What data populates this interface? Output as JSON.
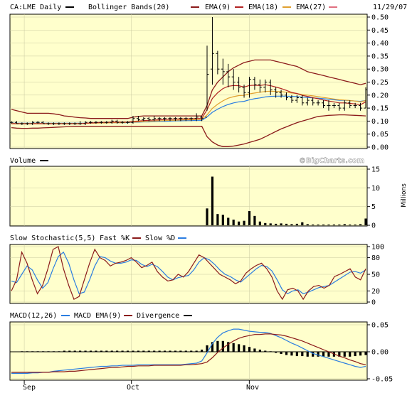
{
  "colors": {
    "panel_bg": "#ffffcc",
    "frame": "#000000",
    "grid": "#c8c8a0",
    "price_bar": "#000000",
    "bollinger": "#8b1a1a",
    "ema9": "#b22222",
    "ema18": "#e0a030",
    "ema27": "#2a7de1",
    "ema27_legend": "#e07080",
    "fast_k": "#8b1a1a",
    "slow_d": "#2a7de1",
    "macd": "#2a7de1",
    "macd_ema": "#8b1a1a",
    "divergence": "#000000"
  },
  "date": "11/29/07",
  "watermark": "©BigCharts.com",
  "month_labels": [
    "Sep",
    "Oct",
    "Nov"
  ],
  "chart_data": [
    {
      "type": "line",
      "panel": "price",
      "legend": [
        "CA:LME Daily",
        "Bollinger Bands(20)",
        "EMA(9)",
        "EMA(18)",
        "EMA(27)"
      ],
      "ylim": [
        0,
        0.5
      ],
      "yticks": [
        "0.50",
        "0.45",
        "0.40",
        "0.35",
        "0.30",
        "0.25",
        "0.20",
        "0.15",
        "0.10",
        "0.05",
        "0.00"
      ],
      "x_dates": [
        "Sep",
        "Oct",
        "Nov"
      ],
      "bars_ohlc": [
        [
          0.095,
          0.1,
          0.09,
          0.095
        ],
        [
          0.095,
          0.1,
          0.09,
          0.09
        ],
        [
          0.09,
          0.095,
          0.085,
          0.09
        ],
        [
          0.09,
          0.095,
          0.085,
          0.09
        ],
        [
          0.09,
          0.1,
          0.085,
          0.095
        ],
        [
          0.095,
          0.1,
          0.09,
          0.095
        ],
        [
          0.095,
          0.1,
          0.09,
          0.09
        ],
        [
          0.09,
          0.095,
          0.085,
          0.09
        ],
        [
          0.09,
          0.095,
          0.085,
          0.09
        ],
        [
          0.09,
          0.095,
          0.085,
          0.09
        ],
        [
          0.09,
          0.095,
          0.085,
          0.09
        ],
        [
          0.09,
          0.095,
          0.085,
          0.09
        ],
        [
          0.09,
          0.095,
          0.085,
          0.09
        ],
        [
          0.09,
          0.1,
          0.085,
          0.09
        ],
        [
          0.09,
          0.1,
          0.085,
          0.095
        ],
        [
          0.095,
          0.1,
          0.09,
          0.095
        ],
        [
          0.095,
          0.1,
          0.09,
          0.095
        ],
        [
          0.095,
          0.1,
          0.09,
          0.095
        ],
        [
          0.095,
          0.1,
          0.09,
          0.095
        ],
        [
          0.095,
          0.105,
          0.09,
          0.1
        ],
        [
          0.1,
          0.105,
          0.09,
          0.095
        ],
        [
          0.095,
          0.1,
          0.09,
          0.095
        ],
        [
          0.095,
          0.1,
          0.09,
          0.095
        ],
        [
          0.095,
          0.12,
          0.09,
          0.11
        ],
        [
          0.11,
          0.12,
          0.1,
          0.105
        ],
        [
          0.105,
          0.115,
          0.1,
          0.11
        ],
        [
          0.11,
          0.115,
          0.1,
          0.105
        ],
        [
          0.105,
          0.12,
          0.1,
          0.11
        ],
        [
          0.11,
          0.115,
          0.1,
          0.11
        ],
        [
          0.11,
          0.115,
          0.1,
          0.11
        ],
        [
          0.11,
          0.115,
          0.1,
          0.11
        ],
        [
          0.11,
          0.115,
          0.1,
          0.11
        ],
        [
          0.11,
          0.115,
          0.1,
          0.11
        ],
        [
          0.11,
          0.115,
          0.1,
          0.11
        ],
        [
          0.11,
          0.115,
          0.1,
          0.11
        ],
        [
          0.11,
          0.13,
          0.1,
          0.115
        ],
        [
          0.115,
          0.12,
          0.1,
          0.11
        ],
        [
          0.115,
          0.39,
          0.14,
          0.28
        ],
        [
          0.3,
          0.5,
          0.24,
          0.36
        ],
        [
          0.36,
          0.37,
          0.28,
          0.3
        ],
        [
          0.3,
          0.34,
          0.24,
          0.29
        ],
        [
          0.29,
          0.32,
          0.23,
          0.27
        ],
        [
          0.27,
          0.3,
          0.22,
          0.25
        ],
        [
          0.25,
          0.27,
          0.21,
          0.23
        ],
        [
          0.23,
          0.24,
          0.19,
          0.21
        ],
        [
          0.21,
          0.27,
          0.19,
          0.26
        ],
        [
          0.26,
          0.27,
          0.22,
          0.24
        ],
        [
          0.24,
          0.26,
          0.21,
          0.23
        ],
        [
          0.23,
          0.26,
          0.21,
          0.25
        ],
        [
          0.25,
          0.26,
          0.2,
          0.22
        ],
        [
          0.22,
          0.23,
          0.19,
          0.21
        ],
        [
          0.21,
          0.22,
          0.19,
          0.2
        ],
        [
          0.2,
          0.21,
          0.18,
          0.19
        ],
        [
          0.19,
          0.2,
          0.17,
          0.18
        ],
        [
          0.18,
          0.2,
          0.17,
          0.19
        ],
        [
          0.19,
          0.2,
          0.16,
          0.17
        ],
        [
          0.17,
          0.19,
          0.16,
          0.18
        ],
        [
          0.18,
          0.19,
          0.16,
          0.17
        ],
        [
          0.17,
          0.18,
          0.16,
          0.17
        ],
        [
          0.17,
          0.18,
          0.15,
          0.16
        ],
        [
          0.16,
          0.18,
          0.14,
          0.16
        ],
        [
          0.16,
          0.17,
          0.15,
          0.16
        ],
        [
          0.16,
          0.17,
          0.14,
          0.15
        ],
        [
          0.15,
          0.18,
          0.14,
          0.17
        ],
        [
          0.17,
          0.18,
          0.15,
          0.16
        ],
        [
          0.16,
          0.17,
          0.15,
          0.16
        ],
        [
          0.16,
          0.17,
          0.14,
          0.15
        ],
        [
          0.15,
          0.23,
          0.15,
          0.22
        ]
      ],
      "bollinger_upper": [
        0.145,
        0.14,
        0.135,
        0.13,
        0.13,
        0.13,
        0.13,
        0.13,
        0.128,
        0.125,
        0.12,
        0.118,
        0.115,
        0.113,
        0.112,
        0.11,
        0.11,
        0.11,
        0.11,
        0.11,
        0.11,
        0.11,
        0.11,
        0.115,
        0.118,
        0.12,
        0.12,
        0.12,
        0.12,
        0.12,
        0.12,
        0.12,
        0.12,
        0.12,
        0.12,
        0.12,
        0.12,
        0.16,
        0.22,
        0.25,
        0.27,
        0.29,
        0.305,
        0.315,
        0.325,
        0.33,
        0.335,
        0.335,
        0.335,
        0.335,
        0.33,
        0.325,
        0.32,
        0.315,
        0.31,
        0.3,
        0.29,
        0.285,
        0.28,
        0.275,
        0.27,
        0.265,
        0.26,
        0.255,
        0.25,
        0.245,
        0.24,
        0.245
      ],
      "bollinger_lower": [
        0.075,
        0.073,
        0.072,
        0.072,
        0.073,
        0.073,
        0.074,
        0.075,
        0.076,
        0.077,
        0.078,
        0.079,
        0.08,
        0.08,
        0.08,
        0.08,
        0.08,
        0.08,
        0.08,
        0.08,
        0.08,
        0.08,
        0.08,
        0.08,
        0.08,
        0.08,
        0.08,
        0.08,
        0.08,
        0.08,
        0.08,
        0.08,
        0.08,
        0.08,
        0.08,
        0.08,
        0.08,
        0.04,
        0.02,
        0.008,
        0.002,
        0.002,
        0.004,
        0.008,
        0.012,
        0.018,
        0.024,
        0.03,
        0.04,
        0.05,
        0.06,
        0.07,
        0.078,
        0.086,
        0.094,
        0.1,
        0.106,
        0.112,
        0.118,
        0.12,
        0.122,
        0.123,
        0.124,
        0.124,
        0.123,
        0.122,
        0.121,
        0.12
      ],
      "ema9": [
        0.09,
        0.09,
        0.09,
        0.09,
        0.09,
        0.09,
        0.09,
        0.09,
        0.09,
        0.09,
        0.09,
        0.09,
        0.09,
        0.09,
        0.092,
        0.093,
        0.094,
        0.095,
        0.095,
        0.096,
        0.096,
        0.096,
        0.096,
        0.099,
        0.1,
        0.102,
        0.103,
        0.104,
        0.105,
        0.106,
        0.107,
        0.108,
        0.108,
        0.109,
        0.109,
        0.11,
        0.11,
        0.144,
        0.187,
        0.209,
        0.225,
        0.234,
        0.237,
        0.236,
        0.231,
        0.237,
        0.238,
        0.237,
        0.24,
        0.236,
        0.231,
        0.225,
        0.218,
        0.21,
        0.206,
        0.199,
        0.195,
        0.19,
        0.186,
        0.181,
        0.177,
        0.174,
        0.17,
        0.17,
        0.168,
        0.166,
        0.163,
        0.174
      ],
      "ema18": [
        0.091,
        0.091,
        0.091,
        0.091,
        0.091,
        0.091,
        0.091,
        0.091,
        0.091,
        0.091,
        0.091,
        0.091,
        0.091,
        0.091,
        0.091,
        0.092,
        0.092,
        0.093,
        0.093,
        0.094,
        0.094,
        0.094,
        0.095,
        0.096,
        0.097,
        0.098,
        0.099,
        0.1,
        0.101,
        0.102,
        0.103,
        0.103,
        0.104,
        0.105,
        0.105,
        0.106,
        0.106,
        0.124,
        0.149,
        0.165,
        0.178,
        0.188,
        0.194,
        0.198,
        0.199,
        0.205,
        0.208,
        0.211,
        0.214,
        0.215,
        0.214,
        0.213,
        0.211,
        0.208,
        0.206,
        0.202,
        0.2,
        0.197,
        0.194,
        0.191,
        0.188,
        0.185,
        0.182,
        0.181,
        0.179,
        0.177,
        0.174,
        0.179
      ],
      "ema27": [
        0.092,
        0.092,
        0.092,
        0.092,
        0.092,
        0.092,
        0.092,
        0.092,
        0.092,
        0.092,
        0.092,
        0.092,
        0.092,
        0.092,
        0.092,
        0.092,
        0.093,
        0.093,
        0.093,
        0.094,
        0.094,
        0.094,
        0.094,
        0.095,
        0.096,
        0.097,
        0.097,
        0.098,
        0.099,
        0.099,
        0.1,
        0.101,
        0.101,
        0.102,
        0.102,
        0.103,
        0.103,
        0.116,
        0.134,
        0.146,
        0.156,
        0.164,
        0.17,
        0.174,
        0.176,
        0.182,
        0.186,
        0.189,
        0.193,
        0.195,
        0.196,
        0.196,
        0.196,
        0.195,
        0.194,
        0.192,
        0.191,
        0.189,
        0.188,
        0.186,
        0.184,
        0.182,
        0.18,
        0.18,
        0.179,
        0.177,
        0.176,
        0.179
      ]
    },
    {
      "type": "bar",
      "panel": "volume",
      "legend": [
        "Volume"
      ],
      "ylabel": "Millions",
      "ylim": [
        0,
        15
      ],
      "yticks": [
        "15",
        "10",
        "5",
        "0"
      ],
      "values": [
        0,
        0,
        0,
        0,
        0,
        0,
        0,
        0,
        0,
        0,
        0,
        0,
        0,
        0,
        0,
        0,
        0,
        0,
        0,
        0,
        0,
        0,
        0,
        0,
        0,
        0,
        0,
        0,
        0,
        0,
        0,
        0,
        0,
        0,
        0,
        0,
        0,
        4.5,
        13,
        3,
        2.8,
        2,
        1.5,
        1,
        1.2,
        3.8,
        2.5,
        1,
        0.6,
        0.5,
        0.4,
        0.5,
        0.4,
        0.3,
        0.4,
        0.8,
        0.3,
        0.2,
        0.2,
        0.2,
        0.2,
        0.2,
        0.2,
        0.3,
        0.2,
        0.2,
        0.3,
        1.8
      ]
    },
    {
      "type": "line",
      "panel": "stochastic",
      "legend": [
        "Slow Stochastic(5,5)",
        "Fast %K",
        "Slow %D"
      ],
      "ylim": [
        0,
        100
      ],
      "yticks": [
        "100",
        "80",
        "50",
        "20",
        "0"
      ],
      "fast_k": [
        20,
        40,
        90,
        70,
        40,
        15,
        30,
        60,
        95,
        100,
        60,
        30,
        5,
        10,
        40,
        70,
        95,
        80,
        75,
        65,
        70,
        72,
        75,
        80,
        72,
        62,
        66,
        72,
        55,
        45,
        38,
        40,
        50,
        45,
        55,
        70,
        85,
        80,
        70,
        60,
        50,
        45,
        40,
        33,
        38,
        52,
        60,
        66,
        70,
        60,
        45,
        20,
        5,
        22,
        25,
        20,
        5,
        20,
        28,
        30,
        25,
        30,
        46,
        50,
        55,
        60,
        45,
        40,
        60
      ],
      "slow_d": [
        38,
        35,
        50,
        65,
        58,
        40,
        25,
        35,
        60,
        82,
        90,
        70,
        40,
        15,
        18,
        40,
        65,
        82,
        80,
        74,
        70,
        70,
        72,
        76,
        75,
        68,
        64,
        68,
        64,
        55,
        45,
        40,
        44,
        46,
        48,
        58,
        72,
        80,
        76,
        68,
        58,
        50,
        46,
        40,
        36,
        44,
        52,
        60,
        66,
        64,
        56,
        40,
        22,
        15,
        20,
        22,
        15,
        18,
        22,
        26,
        28,
        30,
        36,
        42,
        48,
        54,
        55,
        52,
        58
      ]
    },
    {
      "type": "line",
      "panel": "macd",
      "legend": [
        "MACD(12,26)",
        "MACD EMA(9)",
        "Divergence"
      ],
      "ylim": [
        -0.05,
        0.05
      ],
      "yticks": [
        "0.05",
        "0.00",
        "-0.05"
      ],
      "macd": [
        -0.04,
        -0.04,
        -0.04,
        -0.04,
        -0.039,
        -0.039,
        -0.038,
        -0.038,
        -0.036,
        -0.035,
        -0.034,
        -0.033,
        -0.032,
        -0.031,
        -0.03,
        -0.029,
        -0.028,
        -0.027,
        -0.027,
        -0.026,
        -0.026,
        -0.025,
        -0.025,
        -0.025,
        -0.024,
        -0.024,
        -0.024,
        -0.024,
        -0.024,
        -0.024,
        -0.024,
        -0.024,
        -0.024,
        -0.023,
        -0.022,
        -0.021,
        -0.017,
        -0.002,
        0.015,
        0.027,
        0.035,
        0.039,
        0.042,
        0.042,
        0.04,
        0.038,
        0.037,
        0.036,
        0.036,
        0.034,
        0.03,
        0.026,
        0.021,
        0.016,
        0.012,
        0.007,
        0.002,
        -0.003,
        -0.006,
        -0.009,
        -0.012,
        -0.015,
        -0.018,
        -0.021,
        -0.024,
        -0.027,
        -0.029,
        -0.027
      ],
      "macd_ema": [
        -0.038,
        -0.038,
        -0.038,
        -0.038,
        -0.038,
        -0.038,
        -0.038,
        -0.038,
        -0.037,
        -0.037,
        -0.037,
        -0.036,
        -0.036,
        -0.035,
        -0.034,
        -0.033,
        -0.032,
        -0.031,
        -0.03,
        -0.029,
        -0.029,
        -0.028,
        -0.027,
        -0.027,
        -0.026,
        -0.026,
        -0.026,
        -0.025,
        -0.025,
        -0.025,
        -0.025,
        -0.025,
        -0.025,
        -0.024,
        -0.024,
        -0.023,
        -0.022,
        -0.019,
        -0.011,
        -0.001,
        0.007,
        0.014,
        0.02,
        0.025,
        0.028,
        0.03,
        0.032,
        0.032,
        0.033,
        0.033,
        0.032,
        0.031,
        0.029,
        0.026,
        0.023,
        0.02,
        0.016,
        0.012,
        0.008,
        0.004,
        0.0,
        -0.004,
        -0.008,
        -0.011,
        -0.015,
        -0.018,
        -0.022,
        -0.024
      ],
      "divergence": [
        0,
        0,
        0.001,
        0.001,
        0.001,
        0.001,
        0.001,
        0.001,
        0.001,
        0.001,
        0.002,
        0.002,
        0.002,
        0.002,
        0.002,
        0.002,
        0.002,
        0.002,
        0.002,
        0.002,
        0.002,
        0.002,
        0.002,
        0.002,
        0.002,
        0.002,
        0.002,
        0.002,
        0.002,
        0.002,
        0.002,
        0.002,
        0.002,
        0.002,
        0.002,
        0.002,
        0.004,
        0.012,
        0.018,
        0.02,
        0.02,
        0.018,
        0.016,
        0.014,
        0.012,
        0.009,
        0.006,
        0.004,
        0.002,
        0.001,
        -0.002,
        -0.004,
        -0.006,
        -0.007,
        -0.008,
        -0.008,
        -0.009,
        -0.009,
        -0.009,
        -0.009,
        -0.009,
        -0.009,
        -0.009,
        -0.009,
        -0.009,
        -0.008,
        -0.007,
        -0.006
      ]
    }
  ]
}
